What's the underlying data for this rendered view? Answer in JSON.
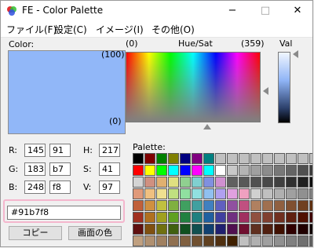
{
  "window": {
    "title": "FE - Color Palette",
    "caption_buttons": [
      "−",
      "□",
      "✕"
    ]
  },
  "menu": [
    "ファイル(F)",
    "設定(C)",
    "イメージ(I)",
    "その他(O)"
  ],
  "color_panel": {
    "label": "Color:",
    "current_color": "#91b7f8"
  },
  "huesat": {
    "min_label": "(0)",
    "title": "Hue/Sat",
    "max_label": "(359)",
    "y_top_label": "(100)",
    "y_bottom_label": "(0)"
  },
  "val": {
    "label": "Val"
  },
  "rgb": [
    {
      "label": "R:",
      "dec": "145",
      "hex": "91"
    },
    {
      "label": "G:",
      "dec": "183",
      "hex": "b7"
    },
    {
      "label": "B:",
      "dec": "248",
      "hex": "f8"
    }
  ],
  "hsv": [
    {
      "label": "H:",
      "value": "217"
    },
    {
      "label": "S:",
      "value": "41"
    },
    {
      "label": "V:",
      "value": "97"
    }
  ],
  "hex_value": "#91b7f8",
  "buttons": {
    "copy": "コピー",
    "screen_color": "画面の色"
  },
  "palette": {
    "label": "Palette:",
    "colors": [
      "#000000",
      "#800000",
      "#008000",
      "#808000",
      "#000080",
      "#800080",
      "#008080",
      "#c0c0c0",
      "#c0c0c0",
      "#c0c0c0",
      "#c0c0c0",
      "#c0c0c0",
      "#c0c0c0",
      "#c0c0c0",
      "#c0c0c0",
      "#c0c0c0",
      "#ff0000",
      "#ffff00",
      "#00ff00",
      "#00ffff",
      "#0000ff",
      "#ff00ff",
      "#00ffff",
      "#ffffff",
      "#c8c8c8",
      "#b4b4b4",
      "#a0a0a0",
      "#8c8c8c",
      "#787878",
      "#646464",
      "#505050",
      "#3c3c3c",
      "#d4d4d4",
      "#d09080",
      "#e0b070",
      "#e0e080",
      "#90d090",
      "#80d0d0",
      "#8090e0",
      "#d090d0",
      "#606060",
      "#585858",
      "#505050",
      "#484848",
      "#404040",
      "#303030",
      "#202020",
      "#101010",
      "#e09a7a",
      "#f0c080",
      "#f0e090",
      "#c0e080",
      "#90e0a0",
      "#90e0e0",
      "#90c0f0",
      "#b0a0f0",
      "#e0a0e0",
      "#f0a0c0",
      "#d0d0d0",
      "#c0c0c0",
      "#b0b0b0",
      "#a0a0a0",
      "#909090",
      "#808080",
      "#c0603a",
      "#d09040",
      "#c0c040",
      "#80b040",
      "#40a060",
      "#40a0a0",
      "#4080c0",
      "#6060c0",
      "#9050a0",
      "#c05080",
      "#b08060",
      "#a07050",
      "#906040",
      "#805030",
      "#704020",
      "#603010",
      "#a03020",
      "#b07020",
      "#a0a020",
      "#60a020",
      "#208040",
      "#208080",
      "#2060a0",
      "#4040a0",
      "#703080",
      "#a03060",
      "#905040",
      "#804030",
      "#703020",
      "#602010",
      "#501000",
      "#400000",
      "#601010",
      "#805010",
      "#707010",
      "#406010",
      "#105020",
      "#105050",
      "#104070",
      "#202070",
      "#501050",
      "#701030",
      "#603020",
      "#502010",
      "#401000",
      "#300000",
      "#200000",
      "#100000",
      "#c0a080",
      "#b09070",
      "#a08060",
      "#907050",
      "#806040",
      "#705030",
      "#604020",
      "#503010",
      "#402000",
      "#c0c0c0",
      "#b0b0b0",
      "#a0a0a0",
      "#909090",
      "#808080",
      "#707070",
      "#606060"
    ]
  }
}
